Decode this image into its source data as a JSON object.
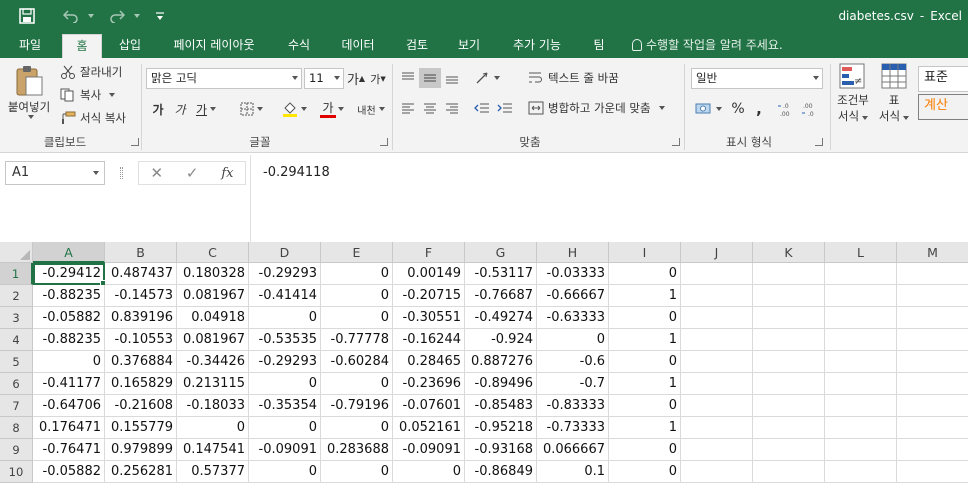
{
  "title_bar": {
    "filename": "diabetes.csv",
    "separator": "-",
    "app": "Excel",
    "accent_color": "#217346"
  },
  "tabs": [
    "파일",
    "홈",
    "삽입",
    "페이지 레이아웃",
    "수식",
    "데이터",
    "검토",
    "보기",
    "추가 기능",
    "팀"
  ],
  "active_tab": "홈",
  "tell_me": {
    "placeholder": "수행할 작업을 알려 주세요."
  },
  "ribbon": {
    "clipboard": {
      "paste": "붙여넣기",
      "cut": "잘라내기",
      "copy": "복사",
      "format_painter": "서식 복사",
      "label": "클립보드"
    },
    "font": {
      "font_name": "맑은 고딕",
      "font_size": "11",
      "grow": "가",
      "shrink": "가",
      "bold": "가",
      "italic": "가",
      "underline": "가",
      "font_color_glyph": "가",
      "phonetic": "내천",
      "label": "글꼴"
    },
    "alignment": {
      "wrap_text": "텍스트 줄 바꿈",
      "merge_center": "병합하고 가운데 맞춤",
      "label": "맞춤"
    },
    "number": {
      "format": "일반",
      "percent": "%",
      "comma": ",",
      "label": "표시 형식"
    },
    "styles": {
      "conditional_line1": "조건부",
      "conditional_line2": "서식",
      "table_line1": "표",
      "table_line2": "서식",
      "normal": "표준",
      "calculation": "계산"
    }
  },
  "formula_bar": {
    "name_box": "A1",
    "fx": "fx",
    "value": "-0.294118"
  },
  "grid": {
    "columns": [
      "A",
      "B",
      "C",
      "D",
      "E",
      "F",
      "G",
      "H",
      "I",
      "J",
      "K",
      "L",
      "M"
    ],
    "selected_column": "A",
    "selected_row": "1",
    "rows": [
      {
        "n": "1",
        "cells": [
          "-0.29412",
          "0.487437",
          "0.180328",
          "-0.29293",
          "0",
          "0.00149",
          "-0.53117",
          "-0.03333",
          "0",
          "",
          "",
          "",
          ""
        ]
      },
      {
        "n": "2",
        "cells": [
          "-0.88235",
          "-0.14573",
          "0.081967",
          "-0.41414",
          "0",
          "-0.20715",
          "-0.76687",
          "-0.66667",
          "1",
          "",
          "",
          "",
          ""
        ]
      },
      {
        "n": "3",
        "cells": [
          "-0.05882",
          "0.839196",
          "0.04918",
          "0",
          "0",
          "-0.30551",
          "-0.49274",
          "-0.63333",
          "0",
          "",
          "",
          "",
          ""
        ]
      },
      {
        "n": "4",
        "cells": [
          "-0.88235",
          "-0.10553",
          "0.081967",
          "-0.53535",
          "-0.77778",
          "-0.16244",
          "-0.924",
          "0",
          "1",
          "",
          "",
          "",
          ""
        ]
      },
      {
        "n": "5",
        "cells": [
          "0",
          "0.376884",
          "-0.34426",
          "-0.29293",
          "-0.60284",
          "0.28465",
          "0.887276",
          "-0.6",
          "0",
          "",
          "",
          "",
          ""
        ]
      },
      {
        "n": "6",
        "cells": [
          "-0.41177",
          "0.165829",
          "0.213115",
          "0",
          "0",
          "-0.23696",
          "-0.89496",
          "-0.7",
          "1",
          "",
          "",
          "",
          ""
        ]
      },
      {
        "n": "7",
        "cells": [
          "-0.64706",
          "-0.21608",
          "-0.18033",
          "-0.35354",
          "-0.79196",
          "-0.07601",
          "-0.85483",
          "-0.83333",
          "0",
          "",
          "",
          "",
          ""
        ]
      },
      {
        "n": "8",
        "cells": [
          "0.176471",
          "0.155779",
          "0",
          "0",
          "0",
          "0.052161",
          "-0.95218",
          "-0.73333",
          "1",
          "",
          "",
          "",
          ""
        ]
      },
      {
        "n": "9",
        "cells": [
          "-0.76471",
          "0.979899",
          "0.147541",
          "-0.09091",
          "0.283688",
          "-0.09091",
          "-0.93168",
          "0.066667",
          "0",
          "",
          "",
          "",
          ""
        ]
      },
      {
        "n": "10",
        "cells": [
          "-0.05882",
          "0.256281",
          "0.57377",
          "0",
          "0",
          "0",
          "-0.86849",
          "0.1",
          "0",
          "",
          "",
          "",
          ""
        ]
      }
    ]
  }
}
